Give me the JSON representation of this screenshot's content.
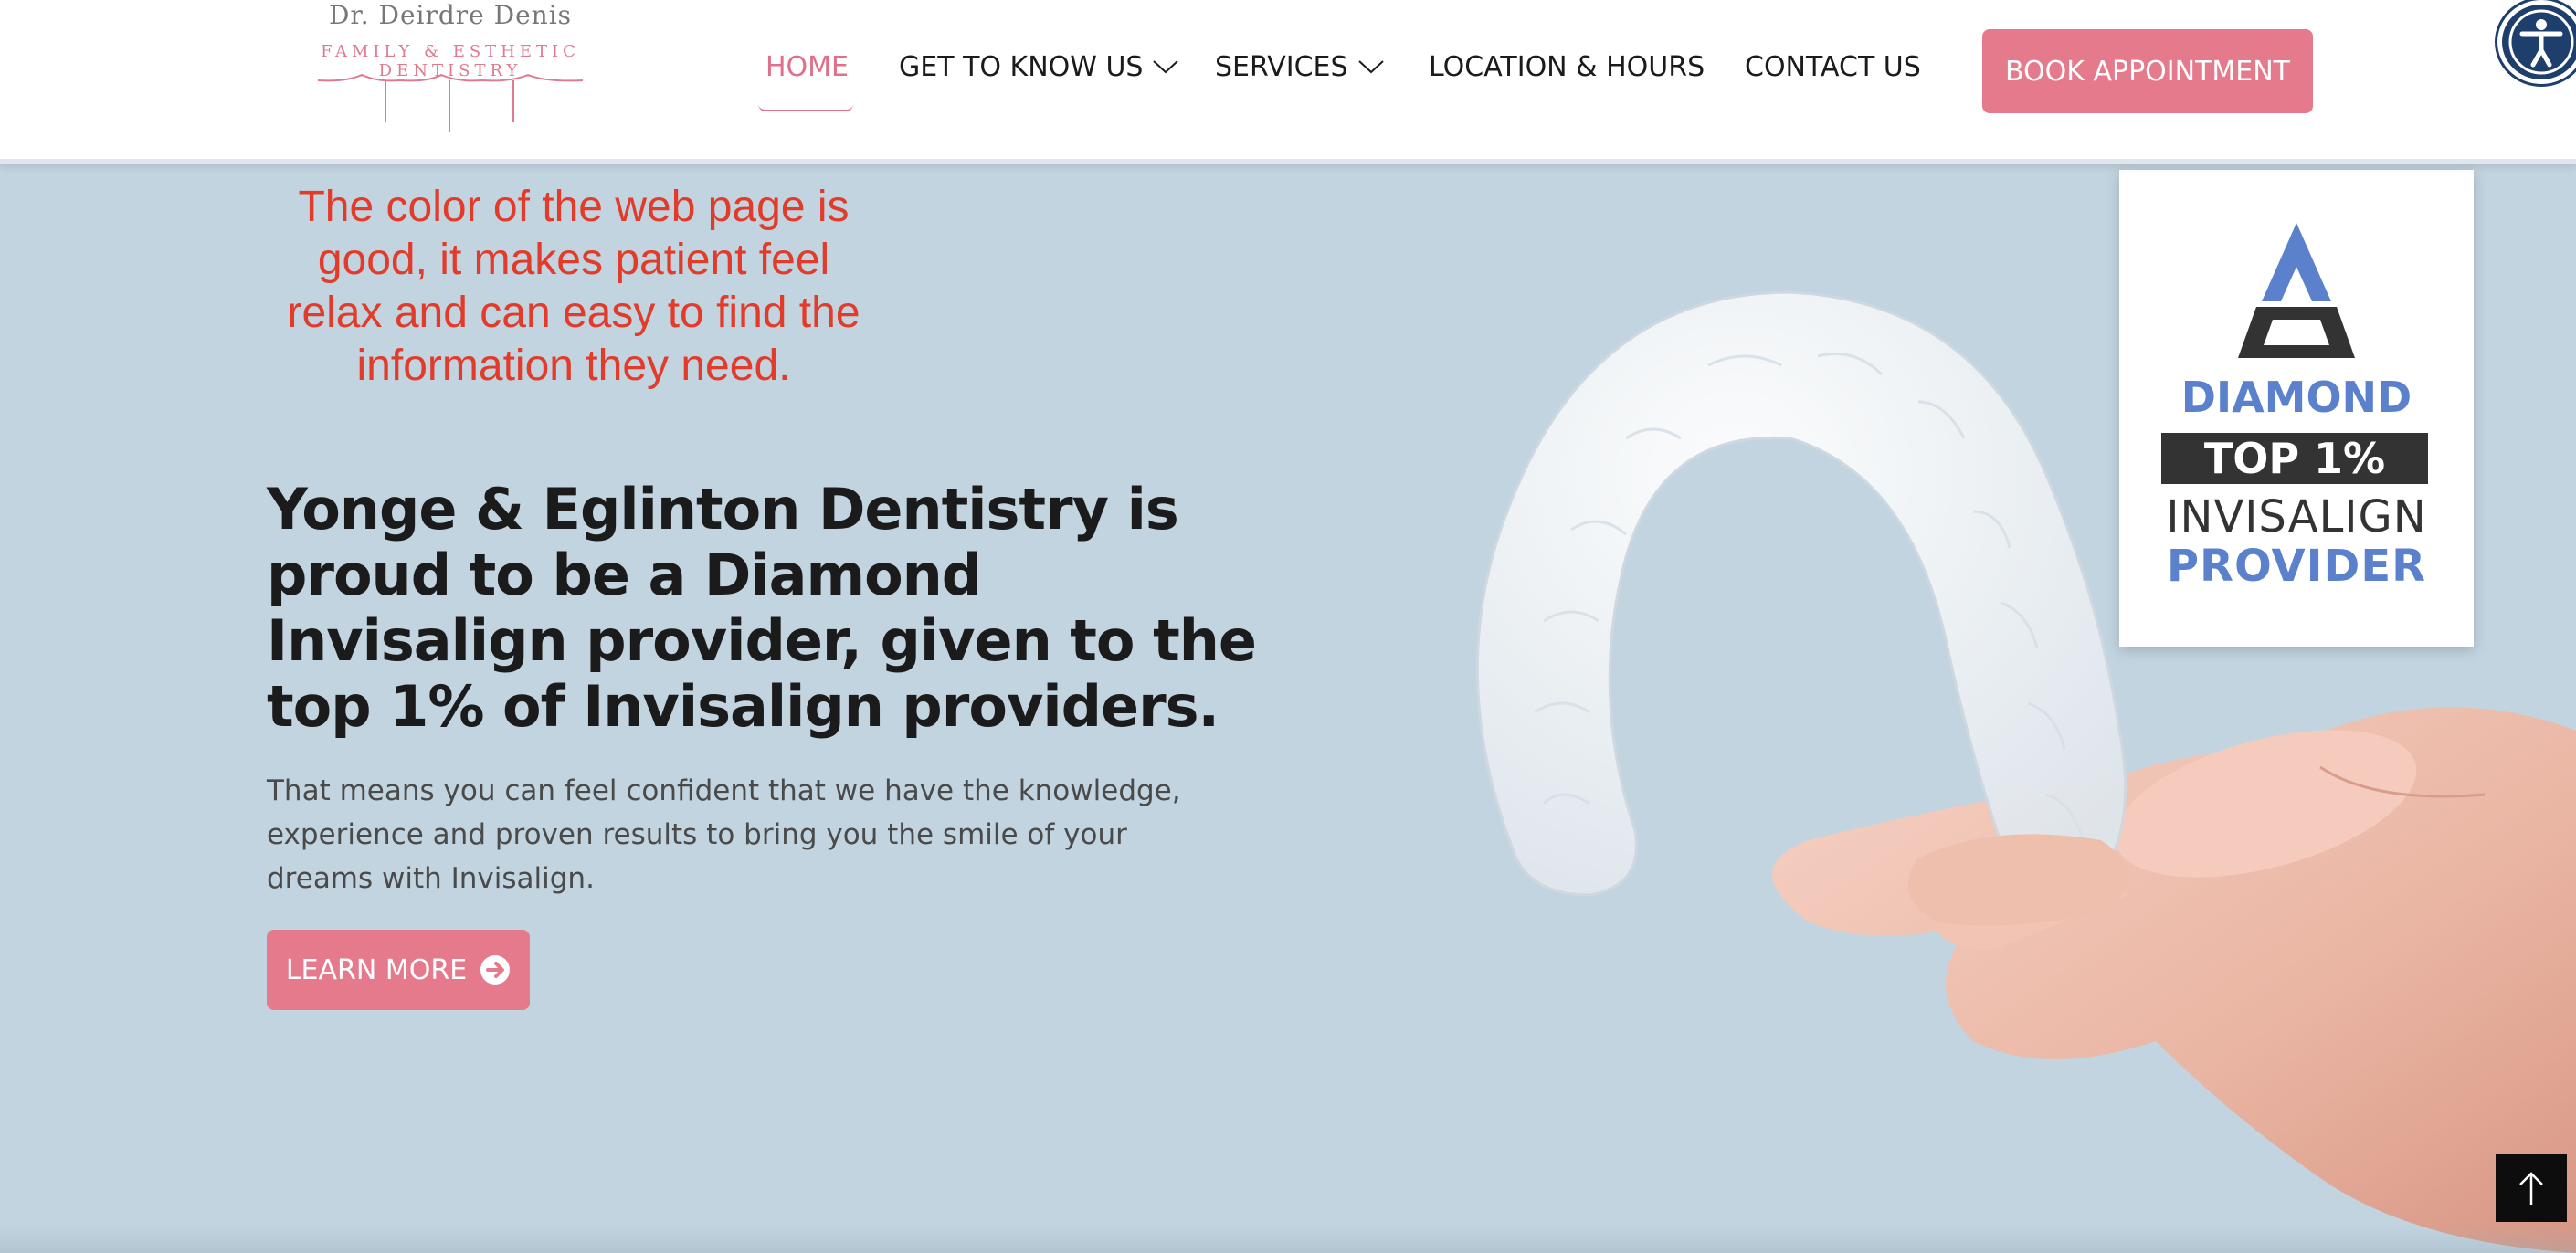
{
  "colors": {
    "accent": "#e57a8c",
    "hero_background": "#c2d4e0",
    "annotation_text": "#e23b2a",
    "badge_blue": "#5b80cc"
  },
  "logo": {
    "name": "Dr. Deirdre Denis",
    "tagline": "FAMILY & ESTHETIC DENTISTRY"
  },
  "nav": {
    "home": "HOME",
    "about": "GET TO KNOW US",
    "services": "SERVICES",
    "location": "LOCATION & HOURS",
    "contact": "CONTACT US",
    "book": "BOOK APPOINTMENT",
    "accessibility_icon": "accessibility-icon"
  },
  "annotation": {
    "text": "The color of the web page is good, it makes patient feel relax and can easy to find the information they need."
  },
  "hero": {
    "headline_normal": "Yonge & Eglinton Dentistry is proud to be a Diamond Invisalign provider, given to the ",
    "headline_bold": "top 1% of Invisalign providers.",
    "body": "That means you can feel confident that we have the knowledge, experience and proven results to bring you the smile of your dreams with Invisalign.",
    "cta": "LEARN MORE",
    "cta_icon": "arrow-circle-right-icon"
  },
  "badge": {
    "line1": "DIAMOND",
    "line2": "TOP 1%",
    "line3": "INVISALIGN",
    "line4": "PROVIDER"
  },
  "scroll_top_icon": "arrow-up-icon"
}
